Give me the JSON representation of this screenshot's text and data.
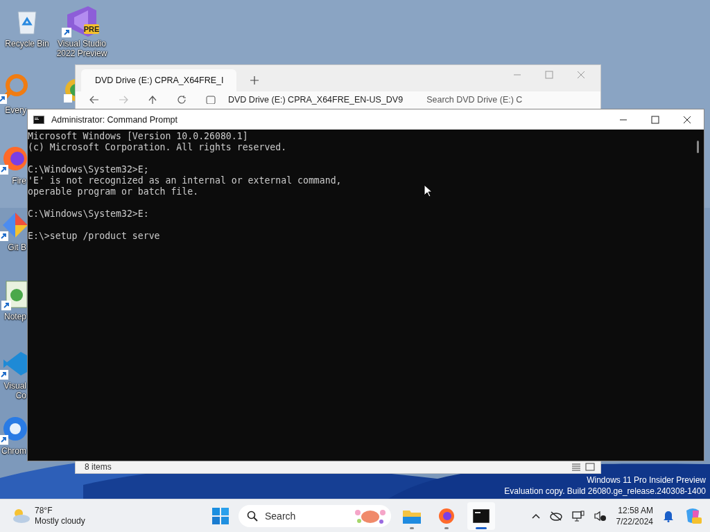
{
  "desktop_icons": [
    {
      "lines": [
        "Recycle Bin"
      ]
    },
    {
      "lines": [
        "Visual Studio",
        "2022 Preview"
      ],
      "badge": "PRE"
    },
    {
      "lines": [
        "Every"
      ]
    },
    {
      "lines": [
        "Fire"
      ]
    },
    {
      "lines": [
        "Git B"
      ]
    },
    {
      "lines": [
        "Notep"
      ]
    },
    {
      "lines": [
        "Visual",
        "Co"
      ]
    },
    {
      "lines": [
        "Chrom"
      ]
    }
  ],
  "explorer": {
    "tab_title": "DVD Drive (E:) CPRA_X64FRE_I",
    "address": "DVD Drive (E:) CPRA_X64FRE_EN-US_DV9",
    "search_placeholder": "Search DVD Drive (E:) C",
    "status": "8 items"
  },
  "console": {
    "title": "Administrator: Command Prompt",
    "groups": [
      [
        "Microsoft Windows [Version 10.0.26080.1]",
        "(c) Microsoft Corporation. All rights reserved."
      ],
      [
        "C:\\Windows\\System32>E;",
        "'E' is not recognized as an internal or external command,",
        "operable program or batch file."
      ],
      [
        "C:\\Windows\\System32>E:"
      ],
      [
        "E:\\>setup /product serve"
      ]
    ]
  },
  "watermark": [
    "Windows 11 Pro Insider Preview",
    "Evaluation copy. Build 26080.ge_release.240308-1400"
  ],
  "taskbar": {
    "weather": {
      "temperature": "78°F",
      "condition": "Mostly cloudy"
    },
    "search": {
      "label": "Search"
    },
    "apps": [
      {
        "running": true,
        "selected": false
      },
      {
        "running": true,
        "selected": false
      },
      {
        "running": true,
        "selected": true
      }
    ],
    "clock": {
      "time": "12:58 AM",
      "date": "7/22/2024"
    }
  }
}
